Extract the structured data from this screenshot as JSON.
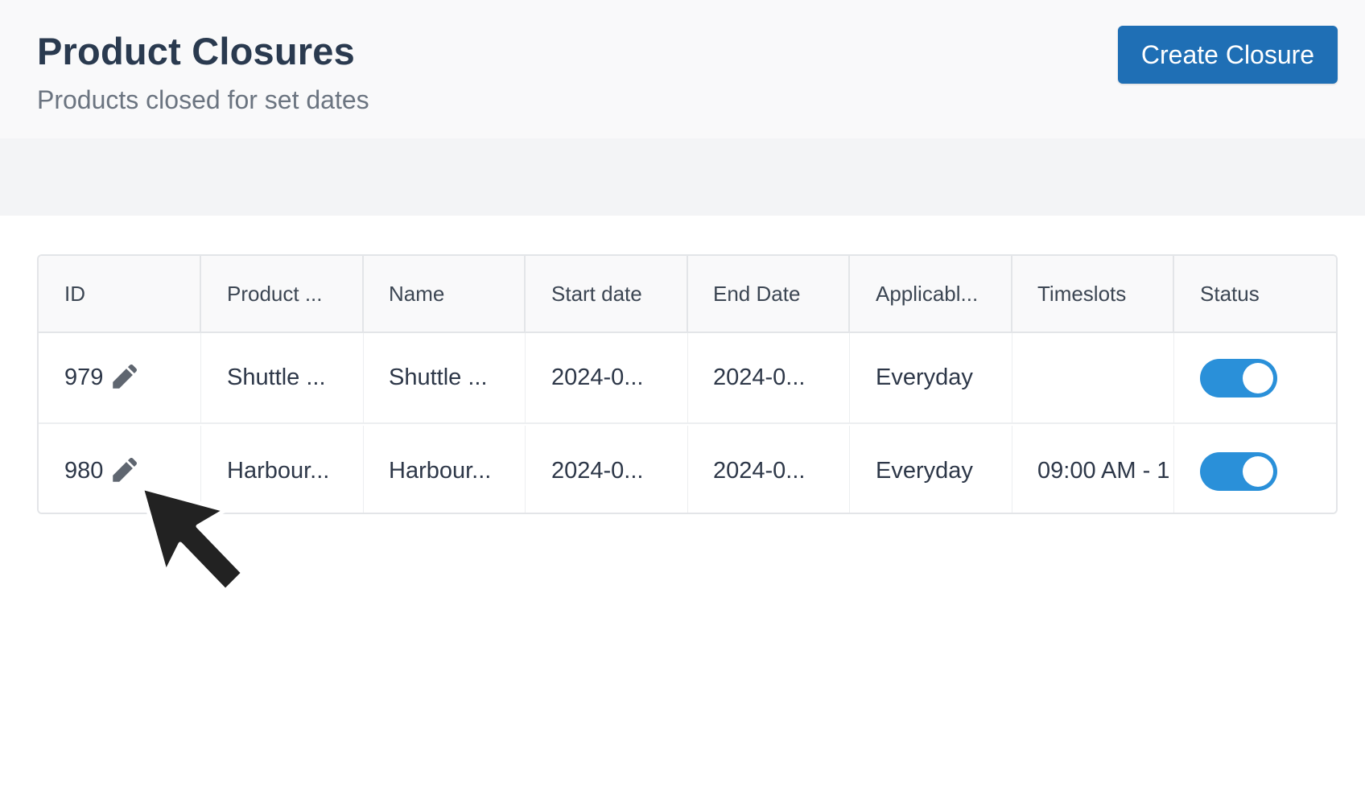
{
  "header": {
    "title": "Product Closures",
    "subtitle": "Products closed for set dates",
    "create_label": "Create Closure"
  },
  "colors": {
    "primary_button": "#1f6fb5",
    "toggle_on": "#2a90d9",
    "header_bg": "#f9f9fa",
    "title_text": "#2a3a4f"
  },
  "table": {
    "columns": [
      "ID",
      "Product ...",
      "Name",
      "Start date",
      "End Date",
      "Applicabl...",
      "Timeslots",
      "Status"
    ],
    "rows": [
      {
        "id": "979",
        "product": "Shuttle ...",
        "name": "Shuttle ...",
        "start_date": "2024-0...",
        "end_date": "2024-0...",
        "applicable": "Everyday",
        "timeslots": "",
        "status_on": true
      },
      {
        "id": "980",
        "product": "Harbour...",
        "name": "Harbour...",
        "start_date": "2024-0...",
        "end_date": "2024-0...",
        "applicable": "Everyday",
        "timeslots": "09:00 AM - 1",
        "status_on": true
      }
    ]
  },
  "icons": {
    "edit": "pencil-icon",
    "cursor": "mouse-pointer-icon"
  }
}
